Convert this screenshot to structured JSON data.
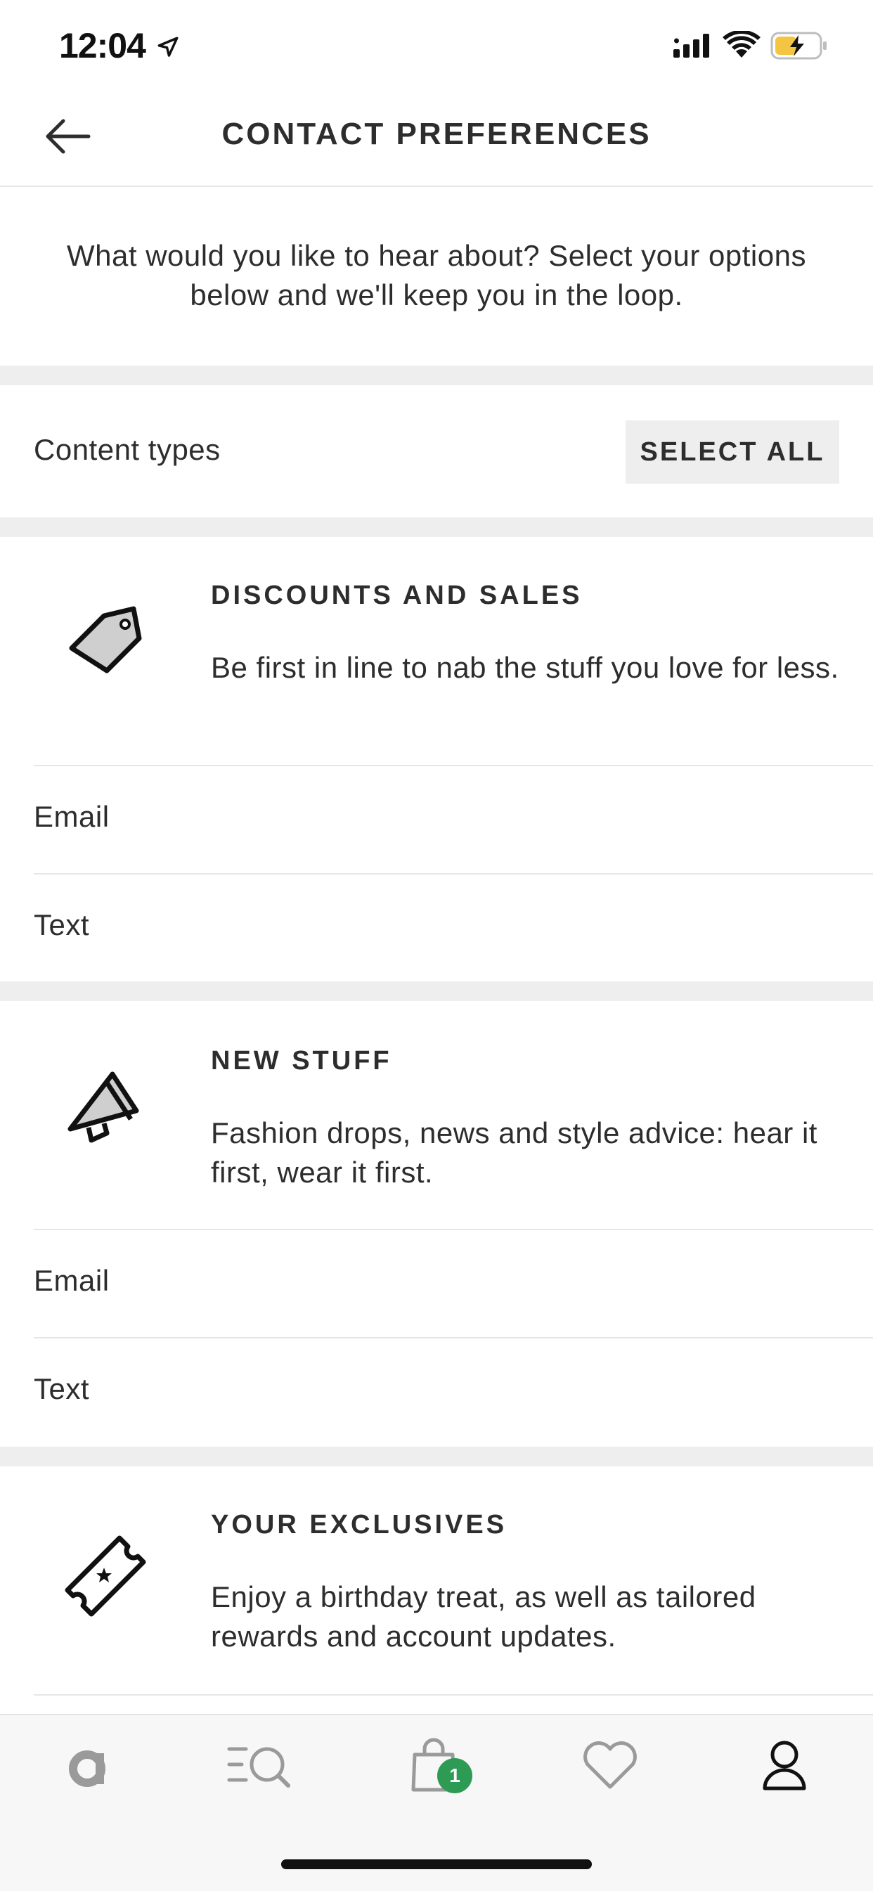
{
  "status_bar": {
    "time": "12:04",
    "icons": [
      "location-arrow-icon",
      "cellular-signal-icon",
      "wifi-icon",
      "battery-charging-icon"
    ],
    "battery_color": "#f4c542"
  },
  "header": {
    "back_icon": "arrow-left-icon",
    "title": "CONTACT PREFERENCES"
  },
  "intro_text": "What would you like to hear about? Select your options below and we'll keep you in the loop.",
  "content_types": {
    "label": "Content types",
    "select_all_label": "SELECT ALL"
  },
  "sections": [
    {
      "icon": "price-tag-icon",
      "title": "DISCOUNTS AND SALES",
      "description": "Be first in line to nab the stuff you love for less.",
      "options": [
        "Email",
        "Text"
      ]
    },
    {
      "icon": "megaphone-icon",
      "title": "NEW STUFF",
      "description": "Fashion drops, news and style advice: hear it first, wear it first.",
      "options": [
        "Email",
        "Text"
      ]
    },
    {
      "icon": "ticket-star-icon",
      "title": "YOUR EXCLUSIVES",
      "description": "Enjoy a birthday treat, as well as tailored rewards and account updates.",
      "options": []
    }
  ],
  "tab_bar": {
    "tabs": [
      {
        "icon": "home-logo-icon",
        "active": false
      },
      {
        "icon": "search-menu-icon",
        "active": false
      },
      {
        "icon": "bag-icon",
        "active": false,
        "badge": "1"
      },
      {
        "icon": "heart-icon",
        "active": false
      },
      {
        "icon": "account-icon",
        "active": true
      }
    ],
    "badge_color": "#2e9b55"
  }
}
